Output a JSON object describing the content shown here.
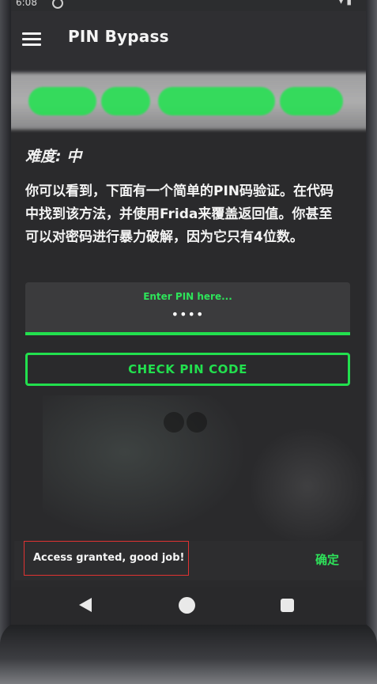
{
  "status_bar": {
    "time": "6:08"
  },
  "app_bar": {
    "title": "PIN Bypass",
    "menu_icon": "hamburger-menu-icon"
  },
  "content": {
    "difficulty": "难度: 中",
    "description": "你可以看到，下面有一个简单的PIN码验证。在代码中找到该方法，并使用Frida来覆盖返回值。你甚至可以对密码进行暴力破解，因为它只有4位数。"
  },
  "pin_input": {
    "label": "Enter PIN here...",
    "value": "••••"
  },
  "check_button": {
    "label": "CHECK PIN CODE"
  },
  "snackbar": {
    "message": "Access granted, good job!",
    "action": "确定"
  },
  "nav_bar": {
    "back_icon": "back-triangle-icon",
    "home_icon": "home-circle-icon",
    "recents_icon": "recents-square-icon"
  },
  "colors": {
    "accent": "#22e04e",
    "background": "#2a2a2c",
    "highlight_box": "#e03232"
  }
}
